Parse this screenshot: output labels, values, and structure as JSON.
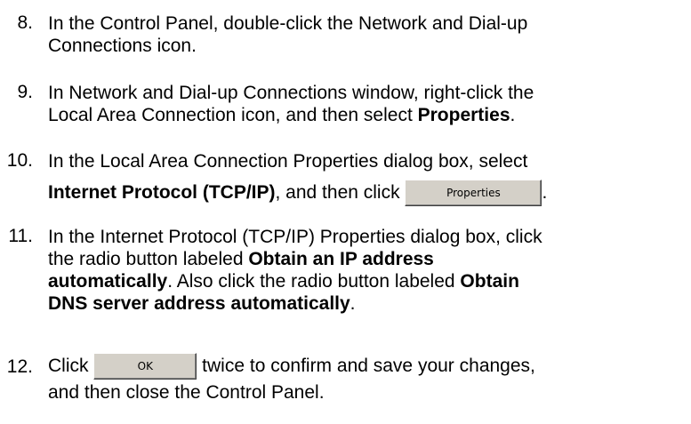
{
  "steps": [
    {
      "number": "8.",
      "lines": [
        [
          "In the Control Panel, double-click the Network and Dial-up"
        ],
        [
          "Connections icon."
        ]
      ]
    },
    {
      "number": "9.",
      "line1": "In Network and Dial-up Connections window, right-click the",
      "line2_prefix": "Local Area Connection icon, and then select ",
      "line2_bold": "Properties",
      "line2_suffix": "."
    },
    {
      "number": "10.",
      "line1": "In the Local Area Connection Properties dialog box, select",
      "line2_bold": "Internet Protocol (TCP/IP)",
      "line2_middle": ", and then click ",
      "button_label": "Properties",
      "line2_suffix": "."
    },
    {
      "number": "11.",
      "line1": "In the Internet Protocol (TCP/IP) Properties dialog box, click",
      "line2_prefix": "the radio button labeled ",
      "line2_bold": "Obtain an IP address",
      "line3_bold": "automatically",
      "line3_middle": ". Also click the radio button labeled ",
      "line3_bold2": "Obtain",
      "line4_bold": "DNS server address automatically",
      "line4_suffix": "."
    },
    {
      "number": "12.",
      "line1_prefix": "Click ",
      "button_label": "OK",
      "line1_suffix": " twice to confirm and save your changes,",
      "line2": "and then close the Control Panel."
    }
  ]
}
